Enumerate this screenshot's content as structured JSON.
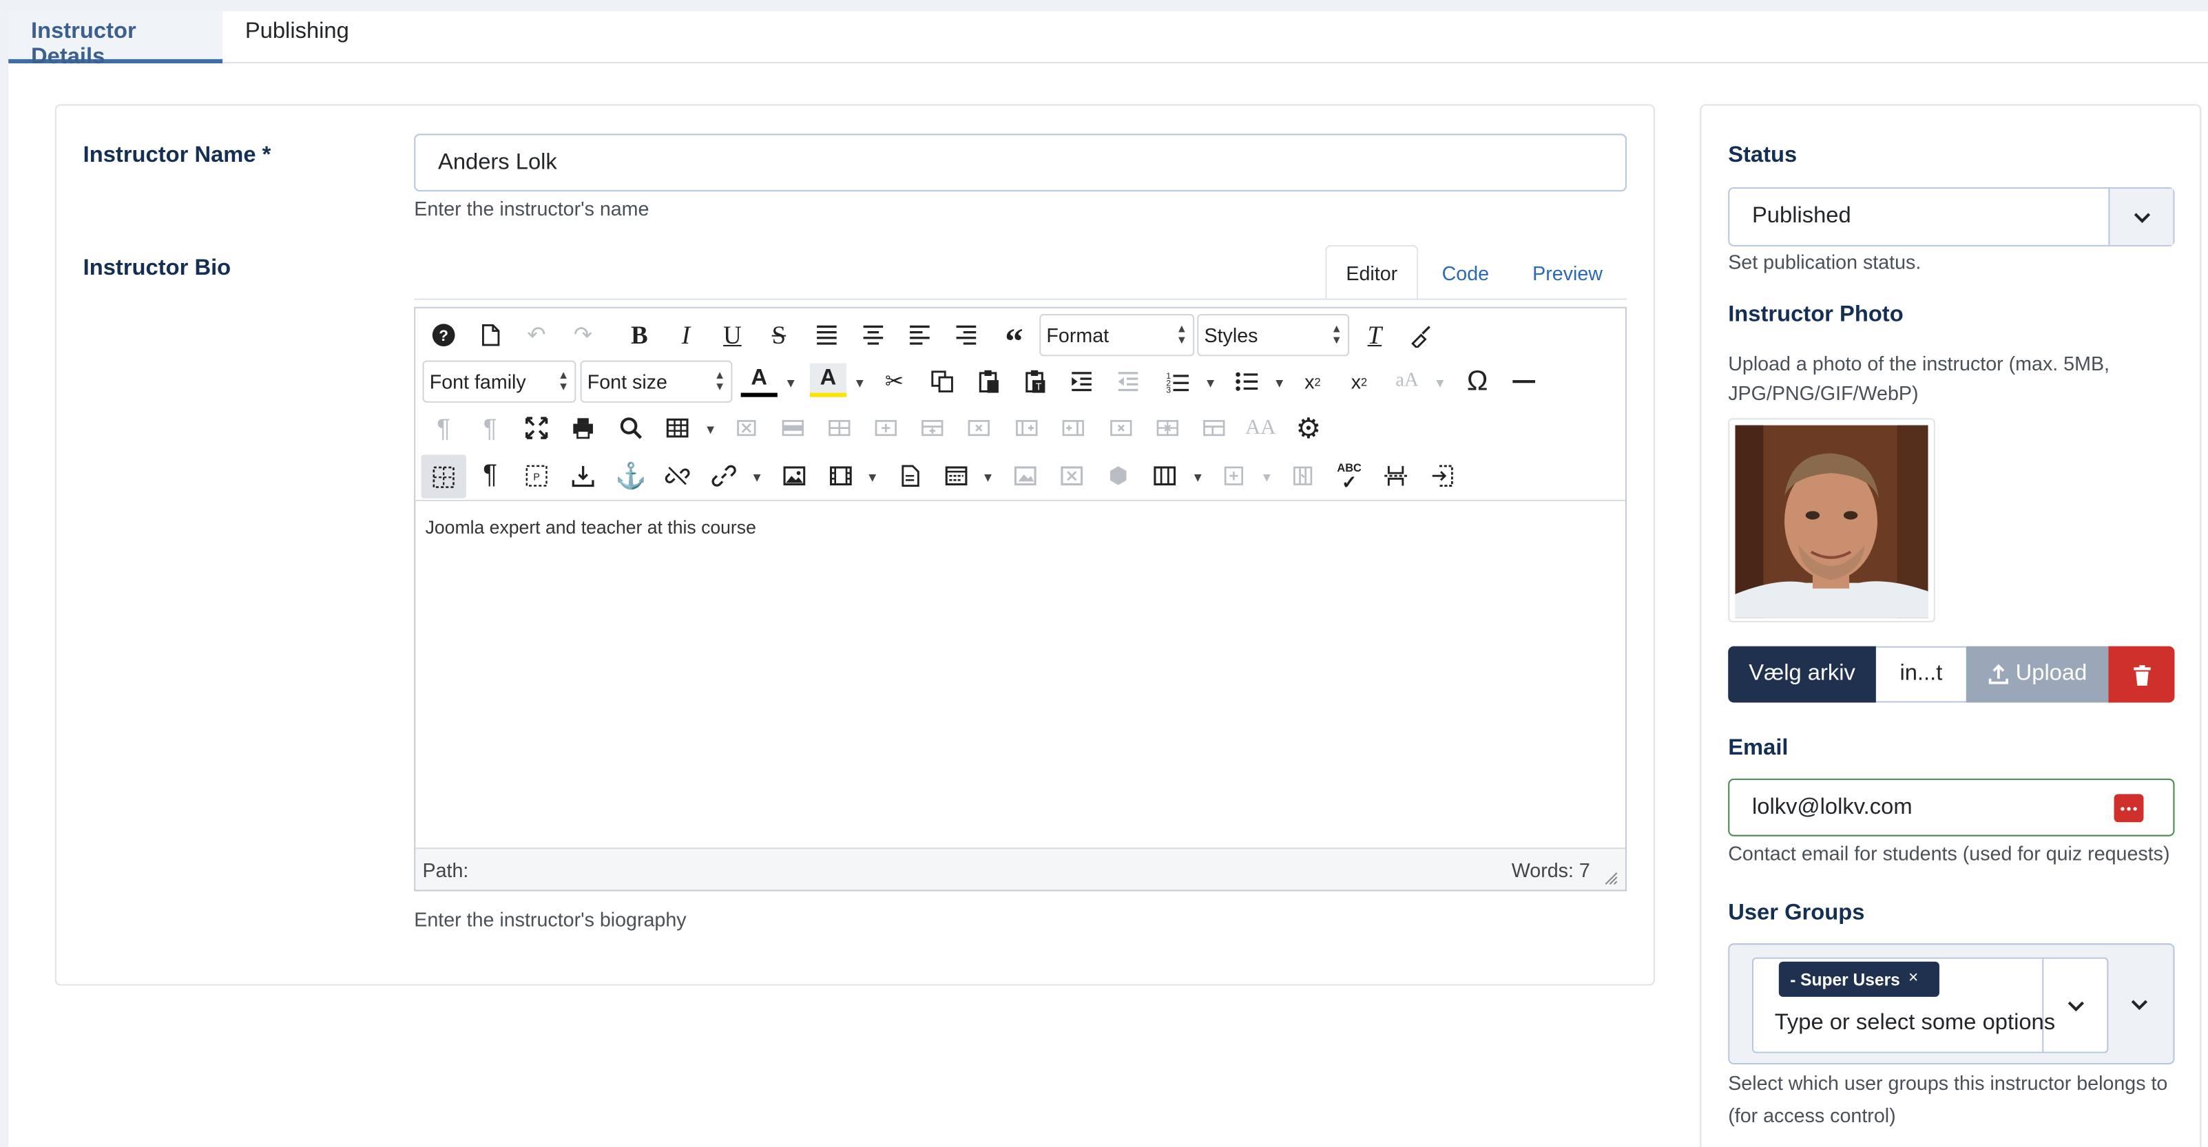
{
  "tabs": [
    {
      "label": "Instructor Details",
      "active": true
    },
    {
      "label": "Publishing",
      "active": false
    }
  ],
  "name_field": {
    "label": "Instructor Name *",
    "value": "Anders Lolk",
    "help": "Enter the instructor's name"
  },
  "bio_field": {
    "label": "Instructor Bio",
    "help": "Enter the instructor's biography"
  },
  "editor": {
    "tabs": [
      "Editor",
      "Code",
      "Preview"
    ],
    "format_label": "Format",
    "styles_label": "Styles",
    "font_family_label": "Font family",
    "font_size_label": "Font size",
    "content": "Joomla expert and teacher at this course",
    "path_label": "Path:",
    "words_label": "Words: 7"
  },
  "status": {
    "label": "Status",
    "value": "Published",
    "help": "Set publication status."
  },
  "photo": {
    "label": "Instructor Photo",
    "help": "Upload a photo of the instructor (max. 5MB, JPG/PNG/GIF/WebP)",
    "choose_label": "Vælg arkiv",
    "file_label": "in...t",
    "upload_label": "Upload"
  },
  "email": {
    "label": "Email",
    "value": "lolkv@lolkv.com",
    "help": "Contact email for students (used for quiz requests)"
  },
  "user_groups": {
    "label": "User Groups",
    "selected": "- Super Users",
    "placeholder": "Type or select some options",
    "help": "Select which user groups this instructor belongs to (for access control)"
  },
  "colors": {
    "accent": "#3f6ea5",
    "label_navy": "#132f53",
    "choose_button": "#203150",
    "upload_button": "#9aa7b8",
    "delete_button": "#d0302b"
  }
}
